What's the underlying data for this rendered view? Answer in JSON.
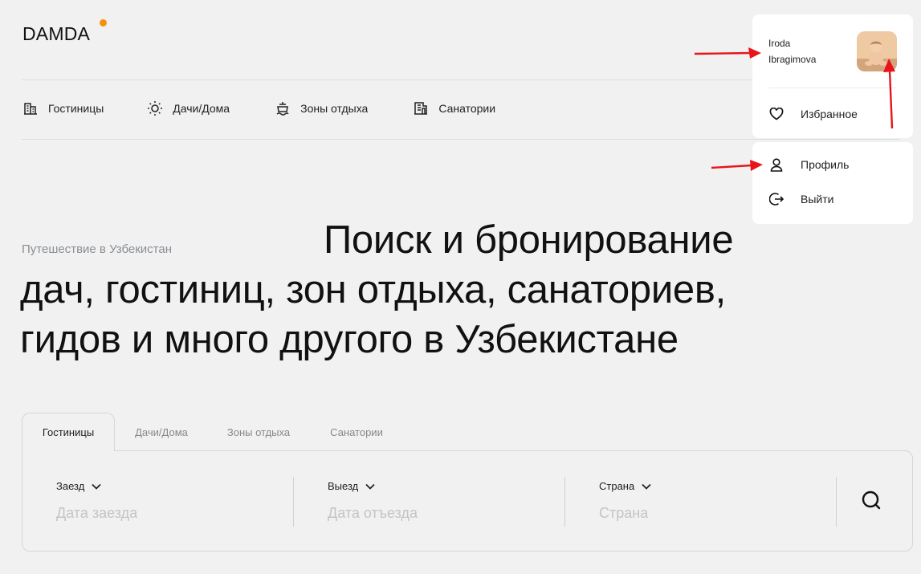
{
  "brand": {
    "name": "DAMDA",
    "accent_color": "#f0920a"
  },
  "nav": {
    "items": [
      {
        "label": "Гостиницы",
        "icon": "hotel-icon"
      },
      {
        "label": "Дачи/Дома",
        "icon": "sun-icon"
      },
      {
        "label": "Зоны отдыха",
        "icon": "lifebuoy-icon"
      },
      {
        "label": "Санатории",
        "icon": "sanatorium-icon"
      }
    ]
  },
  "hero": {
    "eyebrow": "Путешествие в Узбекистан",
    "title_line1": "Поиск и бронирование",
    "title_line2": "дач, гостиниц, зон отдыха, санаториев,",
    "title_line3": "гидов и много другого в Узбекистане"
  },
  "search": {
    "tabs": [
      "Гостиницы",
      "Дачи/Дома",
      "Зоны отдыха",
      "Санатории"
    ],
    "active_tab": "Гостиницы",
    "fields": [
      {
        "label": "Заезд",
        "placeholder": "Дата заезда"
      },
      {
        "label": "Выезд",
        "placeholder": "Дата отъезда"
      },
      {
        "label": "Страна",
        "placeholder": "Страна"
      }
    ],
    "button_icon": "search-icon"
  },
  "user_menu": {
    "name_line1": "Iroda",
    "name_line2": "Ibragimova",
    "avatar_icon": "avatar-photo",
    "items": [
      {
        "label": "Избранное",
        "icon": "heart-icon"
      },
      {
        "label": "Профиль",
        "icon": "user-icon"
      },
      {
        "label": "Выйти",
        "icon": "logout-icon"
      }
    ]
  },
  "annotation_color": "#e8141a"
}
